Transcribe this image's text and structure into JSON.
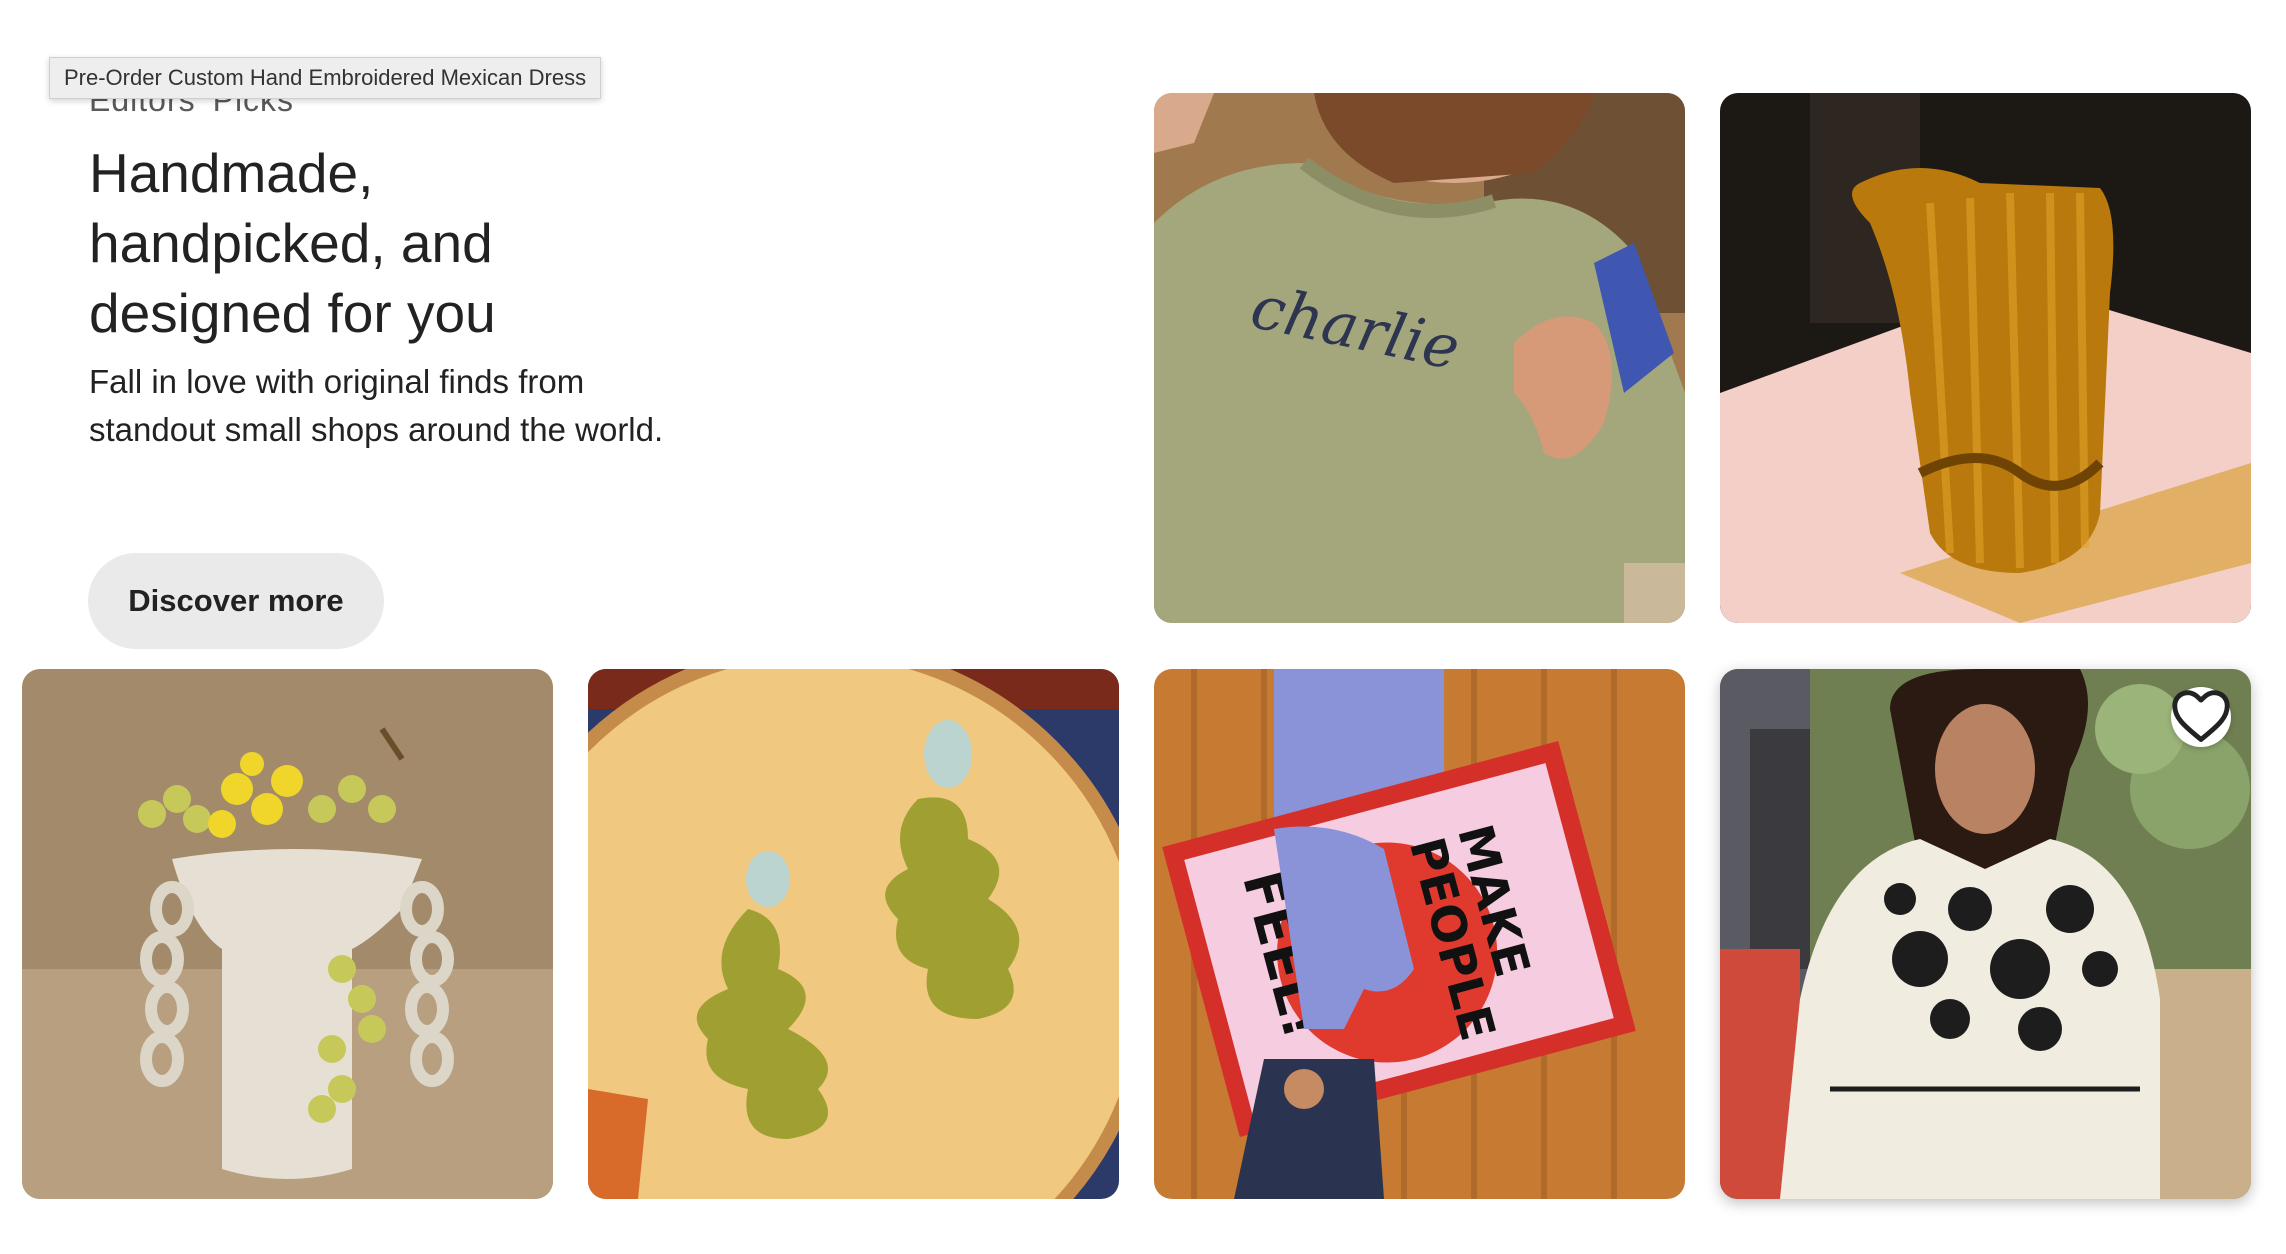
{
  "tooltip": "Pre-Order Custom Hand Embroidered Mexican Dress",
  "editors_picks": {
    "eyebrow": "Editors' Picks",
    "headline": "Handmade, handpicked, and designed for you",
    "subtext": "Fall in love with original finds from standout small shops around the world.",
    "cta_label": "Discover more"
  },
  "tiles": [
    {
      "name": "embroidered-sweatshirt",
      "embroidery_text": "charlie"
    },
    {
      "name": "amber-glass-pitcher"
    },
    {
      "name": "ceramic-chain-vase"
    },
    {
      "name": "olive-clay-earrings"
    },
    {
      "name": "make-people-feel-poster",
      "poster_lines": [
        "MAKE",
        "PEOPLE",
        "FEEL",
        "FEEL",
        "FEEL!"
      ]
    },
    {
      "name": "embroidered-mexican-dress",
      "icon": "heart-icon"
    }
  ],
  "colors": {
    "button_bg": "#eaeaea",
    "text": "#222222"
  }
}
